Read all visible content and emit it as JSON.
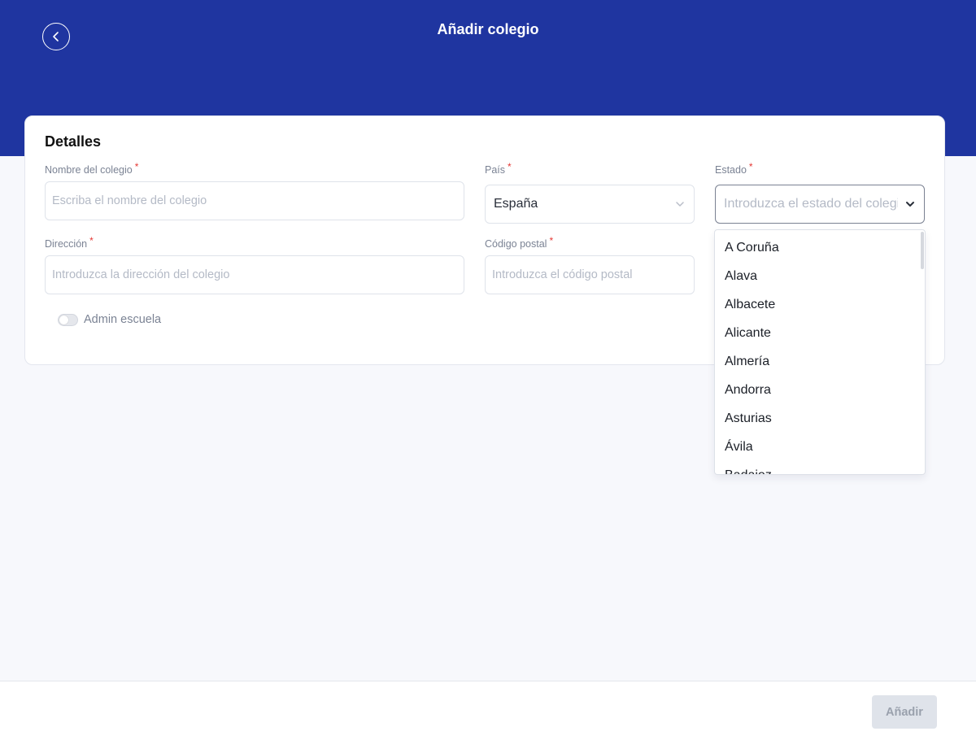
{
  "header": {
    "title": "Añadir colegio",
    "back_icon": "chevron-left-icon",
    "background_color": "#1f35a0"
  },
  "card": {
    "title": "Detalles",
    "fields": {
      "school_name": {
        "label": "Nombre del colegio",
        "required_mark": "*",
        "value": "",
        "placeholder": "Escriba el nombre del colegio"
      },
      "country": {
        "label": "País",
        "required_mark": "*",
        "value": "España"
      },
      "state": {
        "label": "Estado",
        "required_mark": "*",
        "placeholder": "Introduzca el estado del colegio"
      },
      "address": {
        "label": "Dirección",
        "required_mark": "*",
        "value": "",
        "placeholder": "Introduzca la dirección del colegio"
      },
      "postal_code": {
        "label": "Código postal",
        "required_mark": "*",
        "value": "",
        "placeholder": "Introduzca el código postal"
      }
    },
    "toggle": {
      "label": "Admin escuela",
      "on": false
    }
  },
  "state_dropdown": {
    "options": [
      "A Coruña",
      "Alava",
      "Albacete",
      "Alicante",
      "Almería",
      "Andorra",
      "Asturias",
      "Ávila",
      "Badajoz"
    ]
  },
  "footer": {
    "add_label": "Añadir"
  },
  "colors": {
    "required": "#e53935",
    "disabled_button_bg": "#dfe3ea"
  }
}
